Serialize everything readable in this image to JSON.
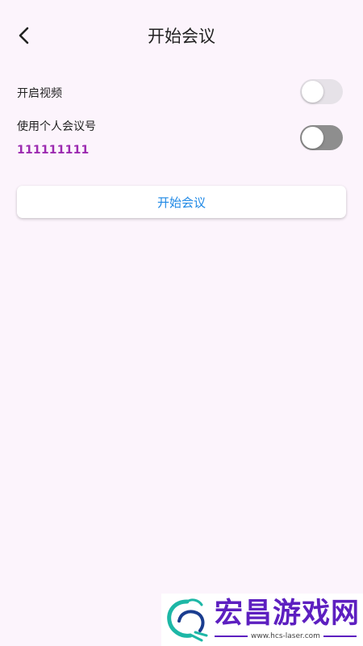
{
  "header": {
    "title": "开始会议",
    "back_icon": "chevron-left-icon"
  },
  "settings": {
    "video": {
      "label": "开启视频",
      "enabled": false
    },
    "personal_meeting_id": {
      "label": "使用个人会议号",
      "number": "111111111",
      "enabled": false
    }
  },
  "actions": {
    "start_label": "开始会议"
  },
  "colors": {
    "background": "#fcf4fc",
    "accent_text": "#1e88e5",
    "meeting_number": "#9c2ab0",
    "switch_off_light": "#e6e2e8",
    "switch_off_dark": "#8e8e8e"
  },
  "watermark": {
    "title": "宏昌游戏网",
    "url": "www.hcs-laser.com",
    "logo_icon": "dragon-logo-icon"
  }
}
